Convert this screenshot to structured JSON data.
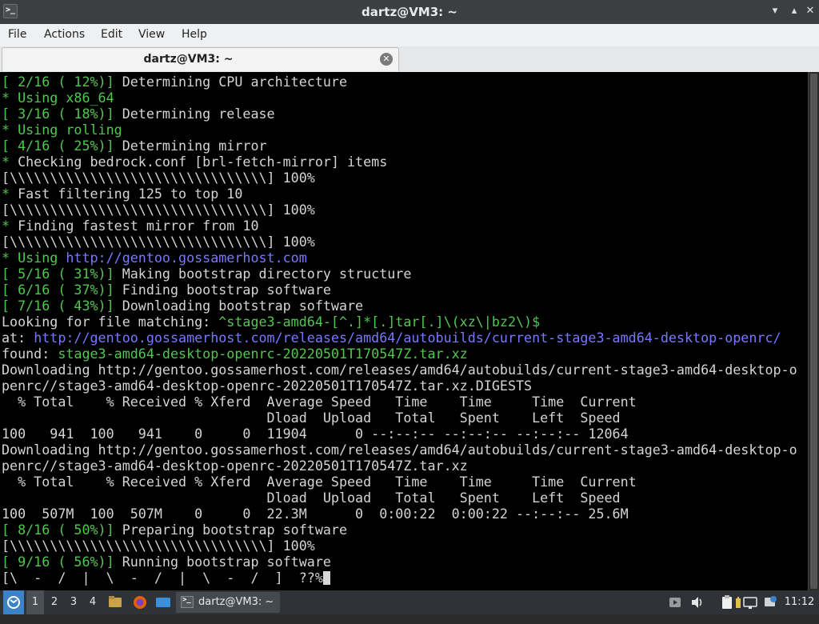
{
  "window": {
    "title": "dartz@VM3: ~",
    "buttons": [
      "restore-icon",
      "maximize-icon",
      "close-icon"
    ]
  },
  "menu": {
    "items": [
      "File",
      "Actions",
      "Edit",
      "View",
      "Help"
    ]
  },
  "tab": {
    "title": "dartz@VM3: ~"
  },
  "colors": {
    "terminal_bg": "#000000",
    "text": "#d4d4d4",
    "green": "#4fc74f",
    "link": "#7878ff"
  },
  "terminal": {
    "lines": [
      [
        {
          "t": "[ 2/16 ( 12%)]",
          "c": "green"
        },
        {
          "t": " Determining CPU architecture"
        }
      ],
      [
        {
          "t": "* Using ",
          "c": "green"
        },
        {
          "t": "x86_64",
          "c": "green"
        }
      ],
      [
        {
          "t": "[ 3/16 ( 18%)]",
          "c": "green"
        },
        {
          "t": " Determining release"
        }
      ],
      [
        {
          "t": "* Using ",
          "c": "green"
        },
        {
          "t": "rolling",
          "c": "green"
        }
      ],
      [
        {
          "t": "[ 4/16 ( 25%)]",
          "c": "green"
        },
        {
          "t": " Determining mirror"
        }
      ],
      [
        {
          "t": "*",
          "c": "green"
        },
        {
          "t": " Checking bedrock.conf [brl-fetch-mirror] items"
        }
      ],
      [
        {
          "t": "[\\\\\\\\\\\\\\\\\\\\\\\\\\\\\\\\\\\\\\\\\\\\\\\\\\\\\\\\\\\\\\\\] 100%"
        }
      ],
      [
        {
          "t": "*",
          "c": "green"
        },
        {
          "t": " Fast filtering 125 to top 10"
        }
      ],
      [
        {
          "t": "[\\\\\\\\\\\\\\\\\\\\\\\\\\\\\\\\\\\\\\\\\\\\\\\\\\\\\\\\\\\\\\\\] 100%"
        }
      ],
      [
        {
          "t": "*",
          "c": "green"
        },
        {
          "t": " Finding fastest mirror from 10"
        }
      ],
      [
        {
          "t": "[\\\\\\\\\\\\\\\\\\\\\\\\\\\\\\\\\\\\\\\\\\\\\\\\\\\\\\\\\\\\\\\\] 100%"
        }
      ],
      [
        {
          "t": "* Using ",
          "c": "green"
        },
        {
          "t": "http://gentoo.gossamerhost.com",
          "c": "link"
        }
      ],
      [
        {
          "t": "[ 5/16 ( 31%)]",
          "c": "green"
        },
        {
          "t": " Making bootstrap directory structure"
        }
      ],
      [
        {
          "t": "[ 6/16 ( 37%)]",
          "c": "green"
        },
        {
          "t": " Finding bootstrap software"
        }
      ],
      [
        {
          "t": "[ 7/16 ( 43%)]",
          "c": "green"
        },
        {
          "t": " Downloading bootstrap software"
        }
      ],
      [
        {
          "t": "Looking for file matching: "
        },
        {
          "t": "^stage3-amd64-[^.]*[.]tar[.]\\(xz\\|bz2\\)$",
          "c": "green"
        }
      ],
      [
        {
          "t": "at: "
        },
        {
          "t": "http://gentoo.gossamerhost.com/releases/amd64/autobuilds/current-stage3-amd64-desktop-openrc/",
          "c": "link"
        }
      ],
      [
        {
          "t": "found: "
        },
        {
          "t": "stage3-amd64-desktop-openrc-20220501T170547Z.tar.xz",
          "c": "green"
        }
      ],
      [
        {
          "t": "Downloading http://gentoo.gossamerhost.com/releases/amd64/autobuilds/current-stage3-amd64-desktop-o"
        }
      ],
      [
        {
          "t": "penrc//stage3-amd64-desktop-openrc-20220501T170547Z.tar.xz.DIGESTS"
        }
      ],
      [
        {
          "t": "  % Total    % Received % Xferd  Average Speed   Time    Time     Time  Current"
        }
      ],
      [
        {
          "t": "                                 Dload  Upload   Total   Spent    Left  Speed"
        }
      ],
      [
        {
          "t": "100   941  100   941    0     0  11904      0 --:--:-- --:--:-- --:--:-- 12064"
        }
      ],
      [
        {
          "t": "Downloading http://gentoo.gossamerhost.com/releases/amd64/autobuilds/current-stage3-amd64-desktop-o"
        }
      ],
      [
        {
          "t": "penrc//stage3-amd64-desktop-openrc-20220501T170547Z.tar.xz"
        }
      ],
      [
        {
          "t": "  % Total    % Received % Xferd  Average Speed   Time    Time     Time  Current"
        }
      ],
      [
        {
          "t": "                                 Dload  Upload   Total   Spent    Left  Speed"
        }
      ],
      [
        {
          "t": "100  507M  100  507M    0     0  22.3M      0  0:00:22  0:00:22 --:--:-- 25.6M"
        }
      ],
      [
        {
          "t": "[ 8/16 ( 50%)]",
          "c": "green"
        },
        {
          "t": " Preparing bootstrap software"
        }
      ],
      [
        {
          "t": "[\\\\\\\\\\\\\\\\\\\\\\\\\\\\\\\\\\\\\\\\\\\\\\\\\\\\\\\\\\\\\\\\] 100%"
        }
      ],
      [
        {
          "t": "[ 9/16 ( 56%)]",
          "c": "green"
        },
        {
          "t": " Running bootstrap software"
        }
      ],
      [
        {
          "t": "[\\  -  /  |  \\  -  /  |  \\  -  /  ]  ??%"
        }
      ]
    ]
  },
  "taskbar": {
    "start_icon": "start-menu-icon",
    "desktops": [
      "1",
      "2",
      "3",
      "4"
    ],
    "launchers": [
      "file-manager-icon",
      "firefox-icon",
      "show-desktop-icon"
    ],
    "task_title": "dartz@VM3: ~",
    "tray": [
      "media-player-icon",
      "volume-icon",
      "clipboard-icon",
      "battery-icon",
      "network-icon",
      "update-icon"
    ],
    "clock": "11:12"
  }
}
